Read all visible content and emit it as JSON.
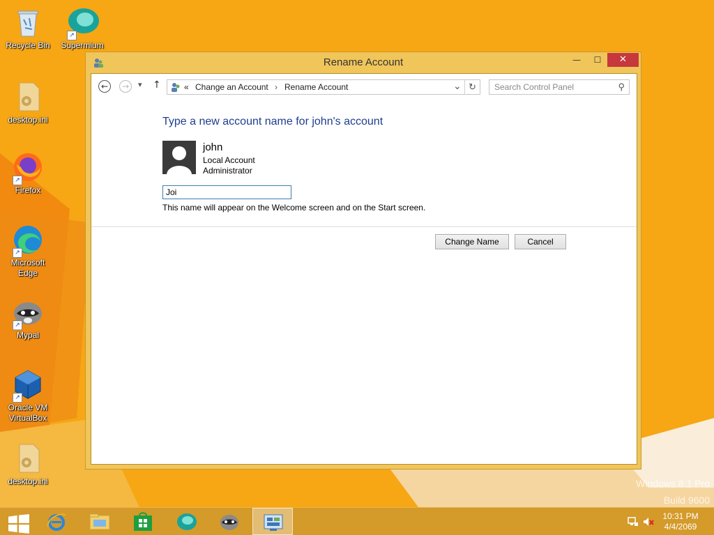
{
  "desktop": {
    "icons": [
      {
        "label": "Recycle Bin"
      },
      {
        "label": "Supermium"
      },
      {
        "label": "desktop.ini"
      },
      {
        "label": "Firefox"
      },
      {
        "label": "Microsoft Edge"
      },
      {
        "label": "Mypal"
      },
      {
        "label": "Oracle VM VirtualBox"
      },
      {
        "label": "desktop.ini"
      }
    ],
    "watermark_line1": "Windows 8.1 Pro",
    "watermark_line2": "Build 9600"
  },
  "window": {
    "title": "Rename Account",
    "controls": {
      "minimize": "—",
      "maximize": "☐",
      "close": "✕"
    },
    "nav": {
      "back": "←",
      "forward": "→",
      "recent": "▾",
      "up": "↑",
      "breadcrumb_prefix": "«",
      "crumb1": "Change an Account",
      "crumb_sep": "›",
      "crumb2": "Rename Account",
      "dropdown": "⌄",
      "refresh": "↻",
      "search_placeholder": "Search Control Panel",
      "search_icon": "⚲"
    },
    "content": {
      "heading": "Type a new account name for john's account",
      "user_name": "john",
      "account_type": "Local Account",
      "account_role": "Administrator",
      "input_value": "Joi",
      "hint": "This name will appear on the Welcome screen and on the Start screen.",
      "change_button": "Change Name",
      "cancel_button": "Cancel"
    }
  },
  "taskbar": {
    "time": "10:31 PM",
    "date": "4/4/2069"
  },
  "colors": {
    "desktop": "#f7a614",
    "window_frame": "#f0c55a",
    "heading": "#1e3d8f",
    "close": "#c7383c"
  }
}
